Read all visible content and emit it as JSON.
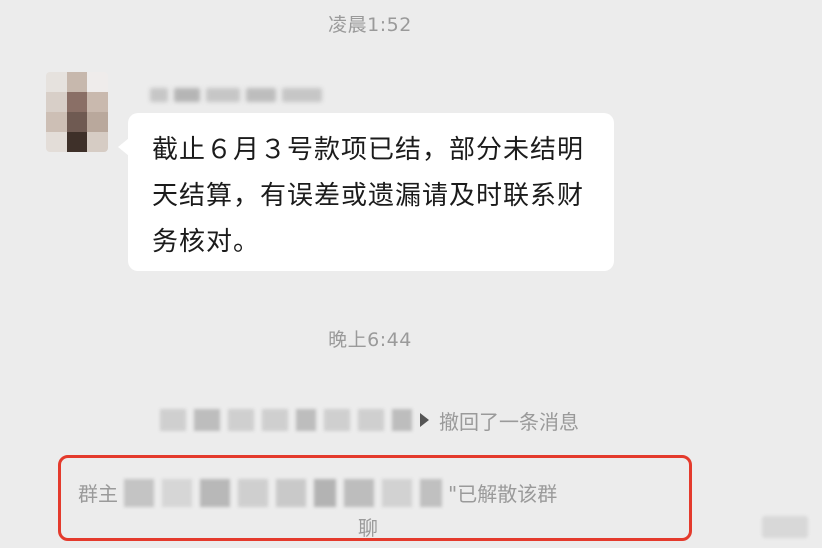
{
  "timestamps": {
    "first": "凌晨1:52",
    "second": "晚上6:44"
  },
  "message": {
    "text": "截止６月３号款项已结，部分未结明天结算，有误差或遗漏请及时联系财务核对。"
  },
  "recall_notice": {
    "text": "撤回了一条消息"
  },
  "disband_notice": {
    "prefix": "群主",
    "suffix": "\"已解散该群",
    "tail": "聊"
  },
  "colors": {
    "background": "#ececec",
    "bubble": "#ffffff",
    "highlight_border": "#e43a2c",
    "system_text": "#9a9a9a"
  }
}
